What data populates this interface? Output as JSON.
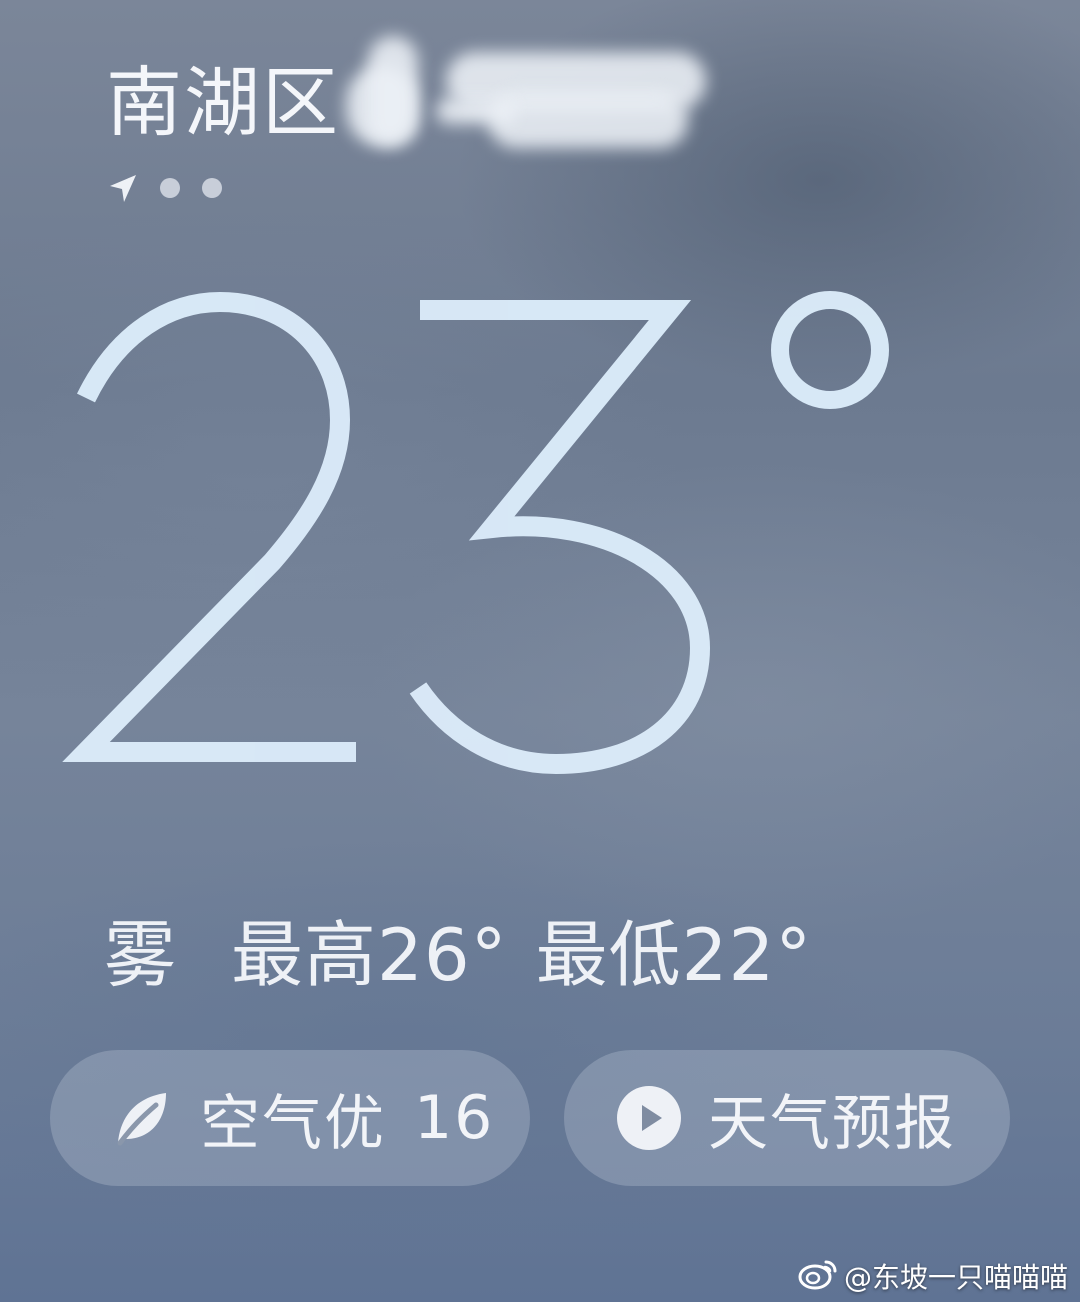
{
  "location": {
    "name": "南湖区"
  },
  "page_indicator": {
    "location_icon": "location-arrow-icon",
    "dot_count": 2
  },
  "current": {
    "temperature": "23",
    "degree_symbol": "°"
  },
  "summary": {
    "condition": "雾",
    "high": "最高26°",
    "low": "最低22°"
  },
  "air_quality": {
    "icon": "leaf-icon",
    "label": "空气优",
    "value": "16"
  },
  "forecast": {
    "icon": "play-circle-icon",
    "label": "天气预报"
  },
  "watermark": {
    "icon": "weibo-icon",
    "text": "@东坡一只喵喵喵"
  },
  "colors": {
    "background": "#6e7d94",
    "big_number": "#dcecfa",
    "pill_bg": "rgba(170,182,200,0.42)",
    "text": "#f2f4f8"
  }
}
